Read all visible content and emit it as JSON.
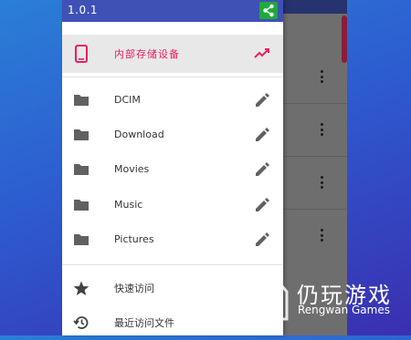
{
  "app": {
    "version": "1.0.1"
  },
  "storage": {
    "label": "内部存储设备"
  },
  "folders": [
    {
      "label": "DCIM"
    },
    {
      "label": "Download"
    },
    {
      "label": "Movies"
    },
    {
      "label": "Music"
    },
    {
      "label": "Pictures"
    }
  ],
  "nav": [
    {
      "label": "快速访问",
      "icon": "star-icon"
    },
    {
      "label": "最近访问文件",
      "icon": "history-icon"
    }
  ],
  "watermark": {
    "title": "仍玩游戏",
    "subtitle": "Rengwan Games"
  },
  "colors": {
    "header": "#3f51b5",
    "accent": "#e91e63",
    "share": "#1faa3a",
    "storage_row_bg": "#e8e8e8"
  }
}
